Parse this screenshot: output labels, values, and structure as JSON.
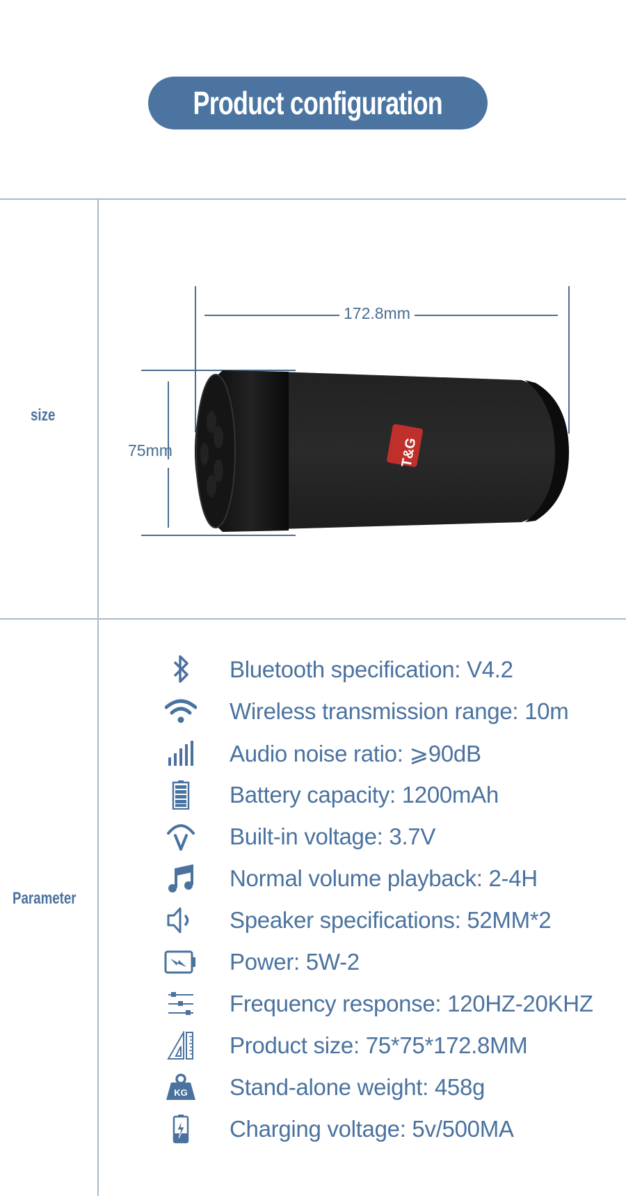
{
  "header": {
    "title": "Product configuration"
  },
  "sections": {
    "size": {
      "label": "size",
      "length_label": "172.8mm",
      "height_label": "75mm",
      "product_image": "speaker-image",
      "brand_badge": "T&G"
    },
    "parameter": {
      "label": "Parameter",
      "items": [
        {
          "icon": "bluetooth-icon",
          "text": "Bluetooth specification: V4.2"
        },
        {
          "icon": "wifi-icon",
          "text": "Wireless transmission range: 10m"
        },
        {
          "icon": "signal-bars-icon",
          "text": "Audio noise ratio: ⩾90dB"
        },
        {
          "icon": "battery-full-icon",
          "text": "Battery capacity: 1200mAh"
        },
        {
          "icon": "voltage-icon",
          "text": "Built-in voltage: 3.7V"
        },
        {
          "icon": "music-note-icon",
          "text": "Normal volume playback: 2-4H"
        },
        {
          "icon": "speaker-icon",
          "text": "Speaker specifications: 52MM*2"
        },
        {
          "icon": "power-battery-icon",
          "text": "Power: 5W-2"
        },
        {
          "icon": "equalizer-icon",
          "text": "Frequency response: 120HZ-20KHZ"
        },
        {
          "icon": "ruler-triangle-icon",
          "text": "Product size: 75*75*172.8MM"
        },
        {
          "icon": "weight-kg-icon",
          "text": "Stand-alone weight: 458g"
        },
        {
          "icon": "charging-battery-icon",
          "text": "Charging voltage: 5v/500MA"
        }
      ]
    }
  },
  "colors": {
    "accent": "#4b74a0",
    "divider": "#a9b9c7",
    "dimension": "#4a6d92"
  }
}
